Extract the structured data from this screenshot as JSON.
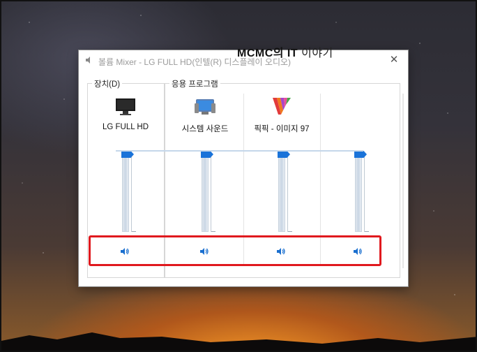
{
  "window": {
    "title": "볼륨 Mixer - LG FULL HD(인텔(R) 디스플레이 오디오)",
    "close_glyph": "✕"
  },
  "watermark": {
    "brand": "MCMC의 IT",
    "tail": " 이야기"
  },
  "groups": {
    "device_label": "장치(D)",
    "apps_label": "응용 프로그램"
  },
  "channels": [
    {
      "name": "LG FULL HD",
      "icon": "monitor-icon",
      "level": 1.0,
      "muted": false
    },
    {
      "name": "시스템 사운드",
      "icon": "system-sounds-icon",
      "level": 1.0,
      "muted": false
    },
    {
      "name": "픽픽 - 이미지 97",
      "icon": "picpick-icon",
      "level": 1.0,
      "muted": false
    },
    {
      "name": "",
      "icon": "",
      "level": 1.0,
      "muted": false
    }
  ],
  "colors": {
    "accent": "#1a73d9",
    "highlight": "#e0191e"
  }
}
